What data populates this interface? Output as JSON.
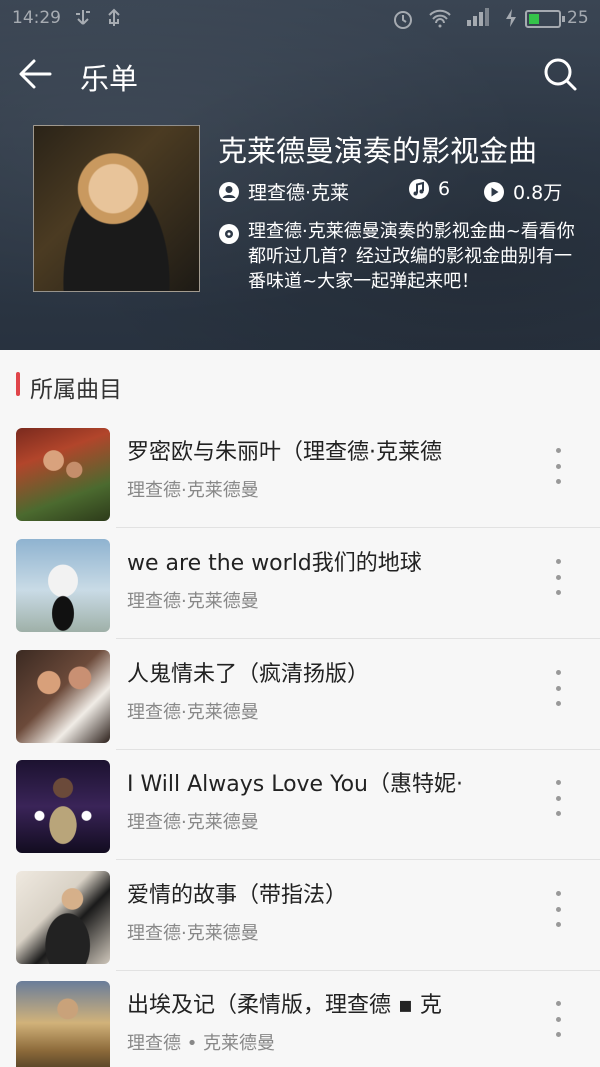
{
  "status": {
    "time": "14:29",
    "battery": "25"
  },
  "app_bar": {
    "title": "乐单",
    "back_icon": "arrow-left-icon",
    "search_icon": "search-icon"
  },
  "playlist": {
    "title": "克莱德曼演奏的影视金曲",
    "author": "理查德·克莱",
    "song_count": "6",
    "play_count": "0.8万",
    "description": "理查德·克莱德曼演奏的影视金曲~看看你都听过几首？经过改编的影视金曲别有一番味道~大家一起弹起来吧！"
  },
  "section": {
    "title": "所属曲目"
  },
  "songs": [
    {
      "title": "罗密欧与朱丽叶（理查德·克莱德",
      "artist": "理查德·克莱德曼"
    },
    {
      "title": "we are the world我们的地球",
      "artist": "理查德·克莱德曼"
    },
    {
      "title": "人鬼情未了（疯清扬版）",
      "artist": "理查德·克莱德曼"
    },
    {
      "title": "I Will Always Love You（惠特妮·",
      "artist": "理查德·克莱德曼"
    },
    {
      "title": "爱情的故事（带指法）",
      "artist": "理查德·克莱德曼"
    },
    {
      "title": "出埃及记（柔情版，理查德 ▪ 克",
      "artist": "理查德 • 克莱德曼"
    }
  ],
  "colors": {
    "accent": "#e0454a",
    "header_bg": "#2f3a48"
  }
}
